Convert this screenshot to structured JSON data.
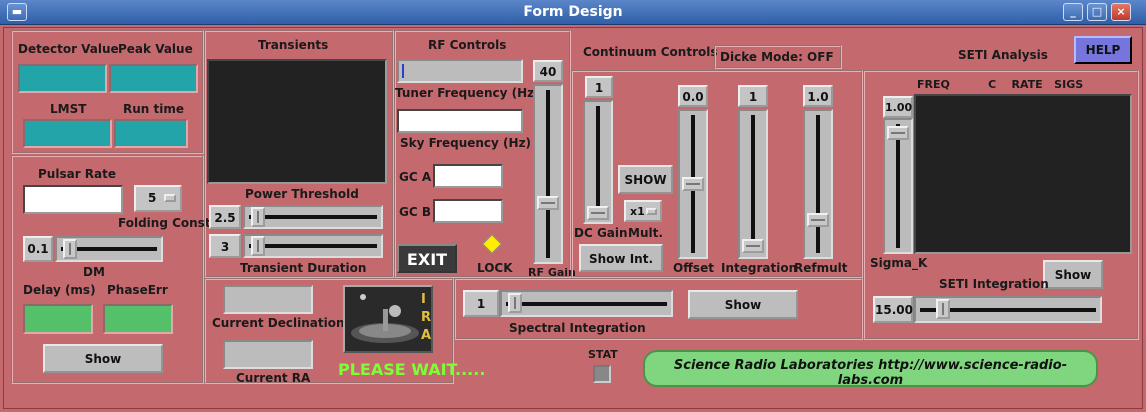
{
  "window": {
    "title": "Form Design",
    "minimize": "_",
    "maximize": "□",
    "close": "×"
  },
  "left": {
    "detector_label": "Detector Value",
    "peak_label": "Peak Value",
    "lmst_label": "LMST",
    "runtime_label": "Run time",
    "pulsar_label": "Pulsar Rate",
    "folding_value": "5",
    "folding_label": "Folding Const",
    "dm_value": "0.1",
    "dm_label": "DM",
    "delay_label": "Delay (ms)",
    "phase_label": "PhaseErr",
    "show_label": "Show"
  },
  "transients": {
    "title": "Transients",
    "power_label": "Power Threshold",
    "power_value": "2.5",
    "duration_value": "3",
    "duration_label": "Transient Duration"
  },
  "position": {
    "declination_label": "Current Declination",
    "ra_label": "Current RA",
    "logo_letters": "IRA",
    "wait_text": "PLEASE WAIT....."
  },
  "rf": {
    "title": "RF Controls",
    "tuner_label": "Tuner Frequency (Hz)",
    "sky_label": "Sky Frequency (Hz)",
    "gca_label": "GC A",
    "gcb_label": "GC B",
    "exit_label": "EXIT",
    "lock_label": "LOCK",
    "rfgain_value": "40",
    "rfgain_label": "RF Gain",
    "lock_color": "#ffee00"
  },
  "continuum": {
    "title": "Continuum Controls",
    "dicke_label": "Dicke Mode: OFF",
    "dcgain_value": "1",
    "dcgain_label": "DC Gain",
    "show_label": "SHOW",
    "mult_value": "x1",
    "mult_label": "Mult.",
    "showint_label": "Show Int.",
    "offset_value": "0.0",
    "offset_label": "Offset",
    "integration_value": "1",
    "integration_label": "Integration",
    "refmult_value": "1.0",
    "refmult_label": "Refmult",
    "spectral_value": "1",
    "spectral_label": "Spectral Integration",
    "spectral_show": "Show"
  },
  "seti": {
    "title": "SETI Analysis",
    "help_label": "HELP",
    "columns": "FREQ          C    RATE   SIGS",
    "sigma_value": "1.00",
    "sigma_label": "Sigma_K",
    "show_label": "Show",
    "integration_label": "SETI Integration",
    "integration_value": "15.00"
  },
  "footer": {
    "stat_label": "STAT",
    "url_text": "Science Radio Laboratories http://www.science-radio-labs.com"
  }
}
